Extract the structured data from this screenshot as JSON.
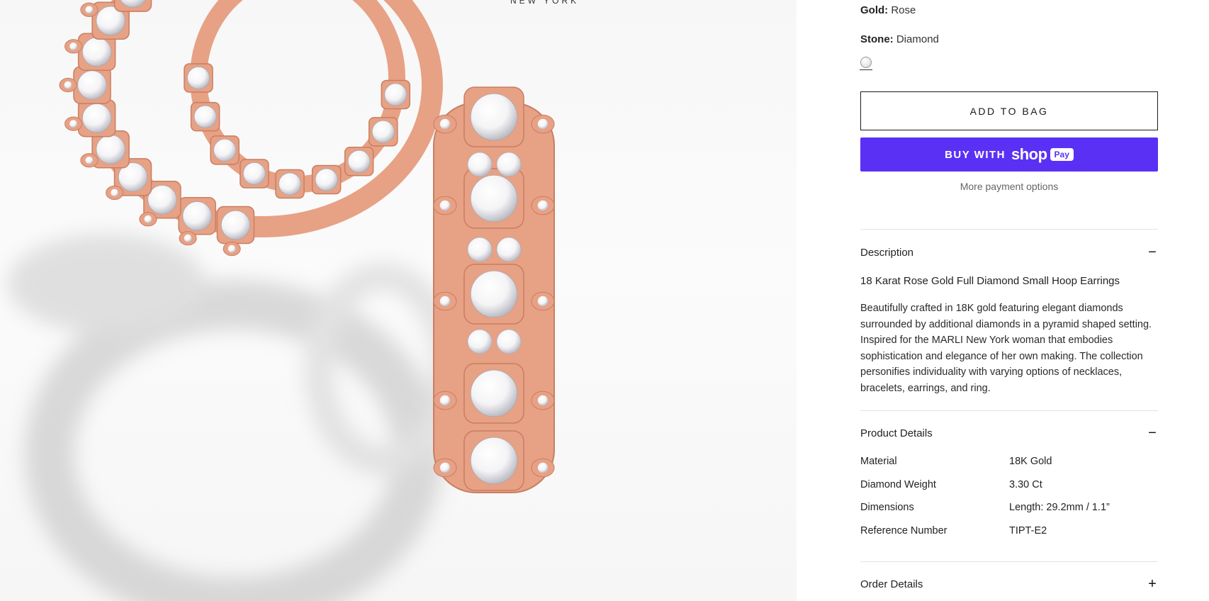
{
  "gallery": {
    "brand_text": "NEW YORK",
    "image_alt": "18 Karat Rose Gold Full Diamond Small Hoop Earrings",
    "metal_color": "#e7a184",
    "diamond_color": "#f4f4f6"
  },
  "options": {
    "gold_label": "Gold:",
    "gold_value": "Rose",
    "stone_label": "Stone:",
    "stone_value": "Diamond",
    "stone_swatch": "diamond-swatch-icon"
  },
  "actions": {
    "add_to_bag": "ADD TO BAG",
    "buy_with": "BUY WITH",
    "shop_text": "shop",
    "pay_badge": "Pay",
    "more_payment": "More payment options",
    "shop_pay_color": "#5a31f4"
  },
  "description": {
    "heading": "Description",
    "toggle": "−",
    "title": "18 Karat Rose Gold Full Diamond Small Hoop Earrings",
    "body": "Beautifully crafted in 18K gold featuring elegant diamonds surrounded by additional diamonds in a pyramid shaped setting. Inspired for the MARLI New York woman that embodies sophistication and elegance of her own making. The collection personifies individuality with varying options of necklaces, bracelets, earrings, and ring."
  },
  "product_details": {
    "heading": "Product Details",
    "toggle": "−",
    "rows": [
      {
        "label": "Material",
        "value": "18K Gold"
      },
      {
        "label": "Diamond Weight",
        "value": "3.30 Ct"
      },
      {
        "label": "Dimensions",
        "value": "Length: 29.2mm / 1.1”"
      },
      {
        "label": "Reference Number",
        "value": "TIPT-E2"
      }
    ]
  },
  "order_details": {
    "heading": "Order Details",
    "toggle": "+"
  }
}
